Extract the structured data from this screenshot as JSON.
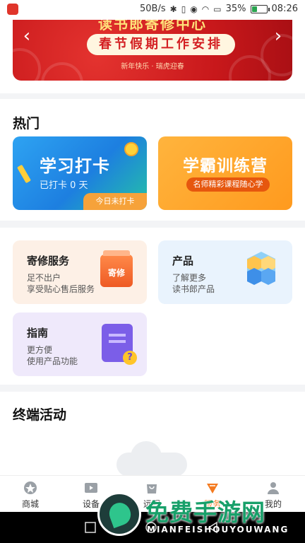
{
  "status_bar": {
    "speed": "50B/s",
    "battery_percent": "35%",
    "battery_level": 0.35,
    "time": "08:26"
  },
  "banner": {
    "top_title": "读书郎寄修中心",
    "title": "春节假期工作安排",
    "subtitle": "新年快乐 · 瑞虎迎春",
    "arrow_left": "‹",
    "arrow_right": "›"
  },
  "hot": {
    "title": "热门",
    "study_card": {
      "title": "学习打卡",
      "subtitle": "已打卡 0 天",
      "tag": "今日未打卡"
    },
    "camp_card": {
      "title": "学霸训练营",
      "pill": "名师精彩课程随心学"
    }
  },
  "services": {
    "repair": {
      "title": "寄修服务",
      "line1": "足不出户",
      "line2": "享受贴心售后服务",
      "icon_label": "寄修"
    },
    "product": {
      "title": "产品",
      "line1": "了解更多",
      "line2": "读书郎产品"
    },
    "guide": {
      "title": "指南",
      "line1": "更方便",
      "line2": "使用产品功能",
      "icon_label": "?"
    }
  },
  "activity": {
    "title": "终端活动"
  },
  "tabs": [
    {
      "label": "商城",
      "icon": "shop-icon"
    },
    {
      "label": "设备",
      "icon": "device-icon"
    },
    {
      "label": "远程",
      "icon": "remote-icon"
    },
    {
      "label": "服务",
      "icon": "service-icon",
      "active": true
    },
    {
      "label": "我的",
      "icon": "profile-icon"
    }
  ],
  "watermark": {
    "text": "免费手游网",
    "sub": "MIANFEISHOUYOUWANG"
  },
  "colors": {
    "accent": "#f47a1f",
    "banner_red": "#c8181b",
    "study_blue": "#1d7fe0",
    "camp_orange": "#ff9a1e"
  }
}
